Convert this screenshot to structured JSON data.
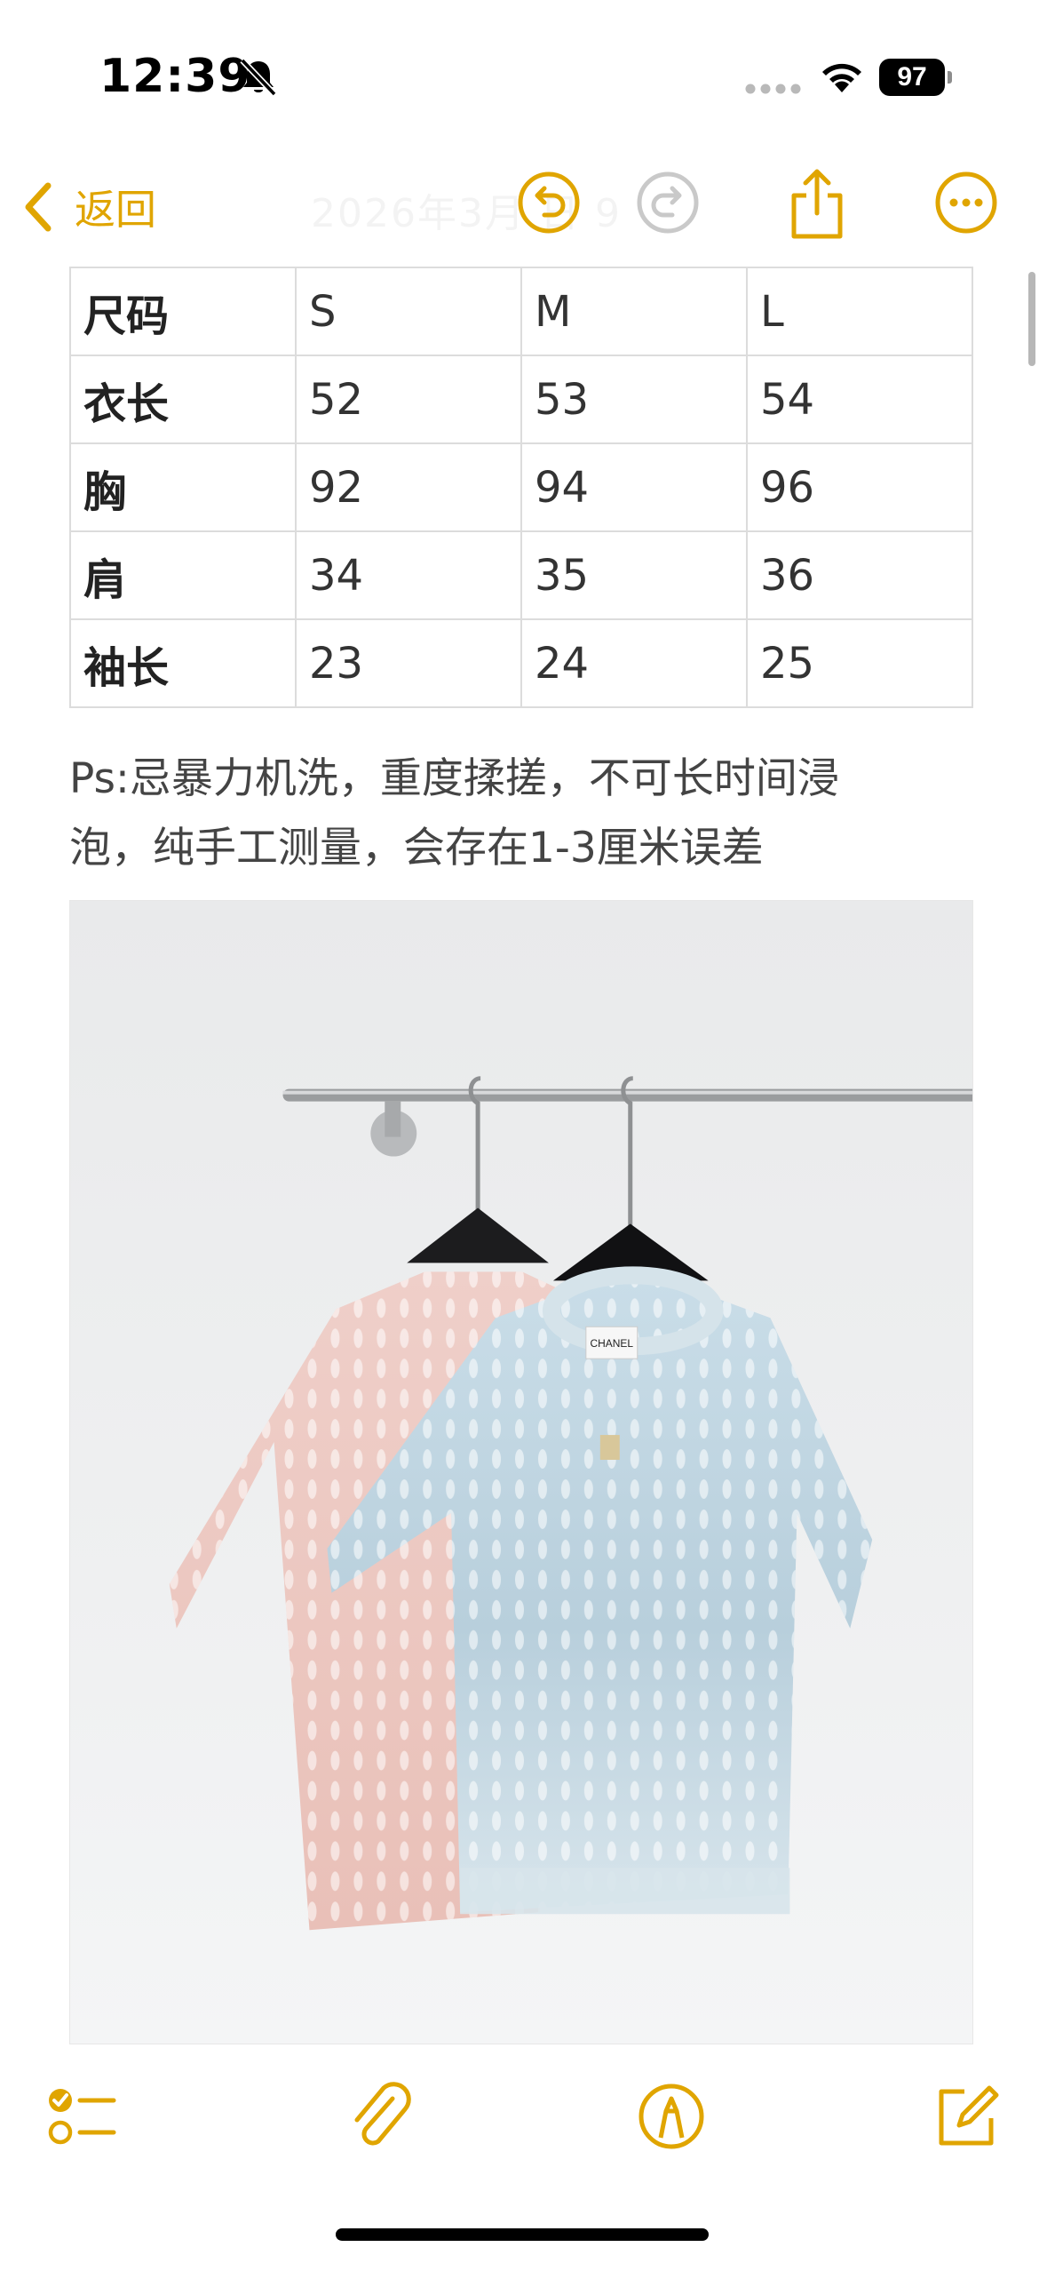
{
  "status_bar": {
    "time": "12:39",
    "battery": "97",
    "icons": [
      "bell-slash-icon",
      "cellular-dots-icon",
      "wifi-icon",
      "battery-icon"
    ]
  },
  "nav": {
    "back_label": "返回",
    "faded_title": "2026年3月 日 9",
    "icons": [
      "chevron-left-icon",
      "undo-icon",
      "redo-icon",
      "share-icon",
      "more-icon"
    ]
  },
  "table": {
    "rows": [
      [
        "尺码",
        "S",
        "M",
        "L"
      ],
      [
        "衣长",
        "52",
        "53",
        "54"
      ],
      [
        "胸",
        "92",
        "94",
        "96"
      ],
      [
        "肩",
        "34",
        "35",
        "36"
      ],
      [
        "袖长",
        "23",
        "24",
        "25"
      ]
    ]
  },
  "note": {
    "line1": "Ps:忌暴力机洗，重度揉搓，不可长时间浸",
    "line2": "泡，纯手工测量，会存在1-3厘米误差"
  },
  "photo": {
    "label": "CHANEL"
  },
  "toolbar": {
    "icons": [
      "checklist-icon",
      "paperclip-icon",
      "markup-pen-icon",
      "compose-icon"
    ]
  },
  "colors": {
    "accent": "#e0a500",
    "accent_disabled": "#c9c9c9",
    "text": "#444444",
    "border": "#dcdcdc"
  }
}
